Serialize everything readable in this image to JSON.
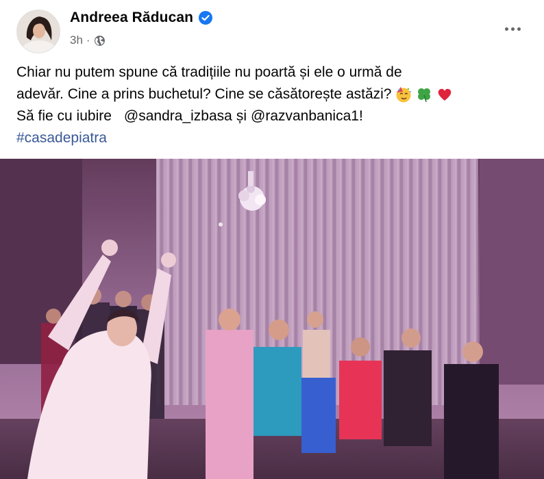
{
  "post": {
    "author": {
      "name": "Andreea Răducan",
      "verified": true,
      "avatar_icon": "profile-photo"
    },
    "timestamp": "3h",
    "separator": "·",
    "privacy_icon": "globe-icon",
    "more_label": "More options",
    "text": {
      "line1": "Chiar nu putem spune că tradițiile nu poartă și ele o urmă de",
      "line2": "adevăr. Cine a prins buchetul? Cine se căsătorește astăzi?",
      "line3_prefix": "Să fie cu iubire",
      "mention1": "@sandra_izbasa",
      "line3_mid": "și",
      "mention2": "@razvanbanica1",
      "line3_suffix": "!",
      "hashtag": "#casadepiatra",
      "emojis": [
        "partying-face",
        "four-leaf-clover",
        "red-heart"
      ]
    },
    "photo": {
      "description_icon": "wedding-bouquet-toss-photo"
    }
  },
  "colors": {
    "link": "#385898",
    "secondary_text": "#65676b",
    "verified_badge": "#1877f2"
  }
}
